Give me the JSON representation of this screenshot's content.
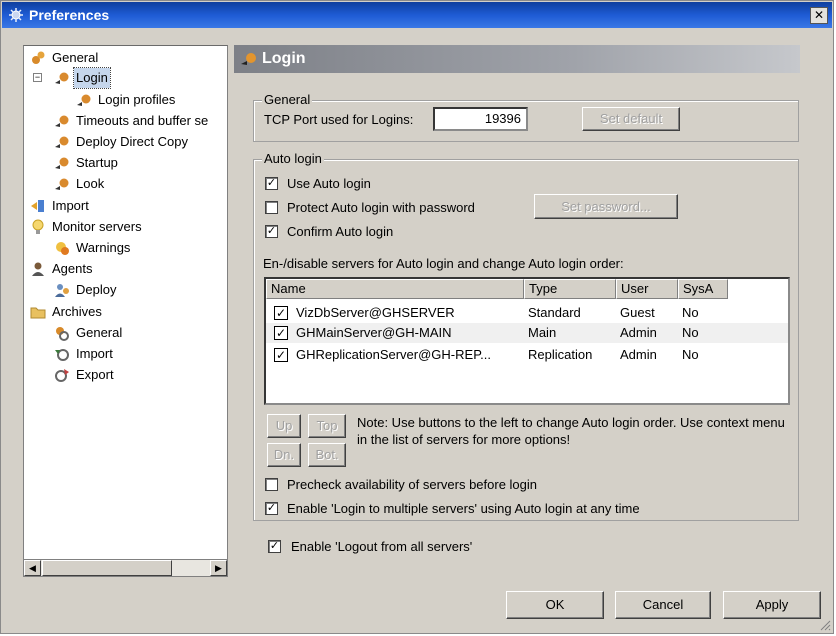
{
  "window": {
    "title": "Preferences",
    "close_glyph": "✕"
  },
  "tree": {
    "items": [
      {
        "label": "General",
        "icon": "general-icon"
      },
      {
        "label": "Login",
        "icon": "login-icon",
        "expander": "−"
      },
      {
        "label": "Login profiles",
        "icon": "login-icon"
      },
      {
        "label": "Timeouts and buffer se",
        "icon": "login-icon"
      },
      {
        "label": "Deploy Direct Copy",
        "icon": "login-icon"
      },
      {
        "label": "Startup",
        "icon": "login-icon"
      },
      {
        "label": "Look",
        "icon": "login-icon"
      },
      {
        "label": "Import",
        "icon": "import-icon"
      },
      {
        "label": "Monitor servers",
        "icon": "lightbulb-icon"
      },
      {
        "label": "Warnings",
        "icon": "warnings-icon"
      },
      {
        "label": "Agents",
        "icon": "agent-icon"
      },
      {
        "label": "Deploy",
        "icon": "deploy-icon"
      },
      {
        "label": "Archives",
        "icon": "archive-icon"
      },
      {
        "label": "General",
        "icon": "archive-general-icon"
      },
      {
        "label": "Import",
        "icon": "archive-import-icon"
      },
      {
        "label": "Export",
        "icon": "archive-export-icon"
      }
    ],
    "scroll_left": "◀",
    "scroll_right": "▶"
  },
  "header": {
    "title": "Login"
  },
  "general_group": {
    "title": "General",
    "tcp_label": "TCP Port used for Logins:",
    "tcp_value": "19396",
    "set_default": "Set default"
  },
  "auto_group": {
    "title": "Auto login",
    "use_auto_login": "Use Auto login",
    "use_auto_login_checked": "✓",
    "protect": "Protect Auto login with password",
    "protect_checked": "",
    "set_password": "Set password...",
    "confirm": "Confirm Auto login",
    "confirm_checked": "✓",
    "servers_label": "En-/disable servers for Auto login and change Auto login order:",
    "columns": [
      "Name",
      "Type",
      "User",
      "SysA"
    ],
    "rows": [
      {
        "checked": "✓",
        "name": "VizDbServer@GHSERVER",
        "type": "Standard",
        "user": "Guest",
        "sysa": "No"
      },
      {
        "checked": "✓",
        "name": "GHMainServer@GH-MAIN",
        "type": "Main",
        "user": "Admin",
        "sysa": "No"
      },
      {
        "checked": "✓",
        "name": "GHReplicationServer@GH-REP...",
        "type": "Replication",
        "user": "Admin",
        "sysa": "No"
      }
    ],
    "btn_up": "Up",
    "btn_top": "Top",
    "btn_dn": "Dn.",
    "btn_bot": "Bot.",
    "note": "Note: Use buttons to the left to change Auto login order. Use context menu in the list of servers for more options!",
    "precheck": "Precheck availability of servers before login",
    "precheck_checked": "",
    "multi": "Enable 'Login to multiple servers' using Auto login at any time",
    "multi_checked": "✓"
  },
  "logout": {
    "label": "Enable 'Logout from all servers'",
    "checked": "✓"
  },
  "footer": {
    "ok": "OK",
    "cancel": "Cancel",
    "apply": "Apply"
  }
}
